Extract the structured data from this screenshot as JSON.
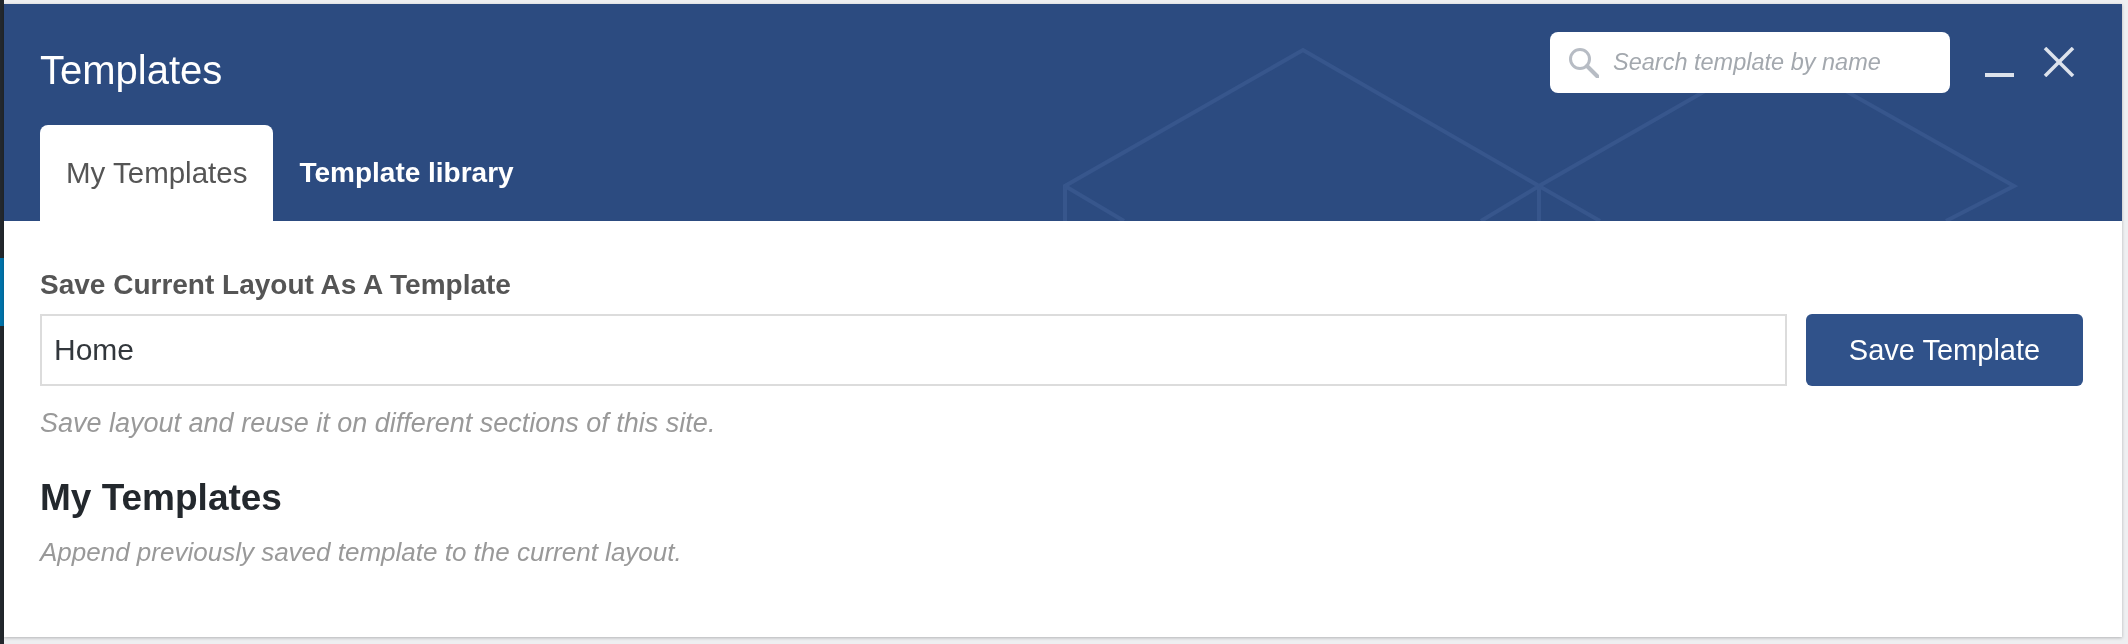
{
  "window": {
    "title": "Templates"
  },
  "search": {
    "placeholder": "Search template by name"
  },
  "tabs": [
    {
      "label": "My Templates",
      "selected": true
    },
    {
      "label": "Template library",
      "selected": false
    }
  ],
  "save_form": {
    "label": "Save Current Layout As A Template",
    "input": {
      "value": "Home"
    },
    "button": "Save Template",
    "hint": "Save layout and reuse it on different sections of this site."
  },
  "my_templates": {
    "heading": "My Templates",
    "description": "Append previously saved template to the current layout."
  }
}
